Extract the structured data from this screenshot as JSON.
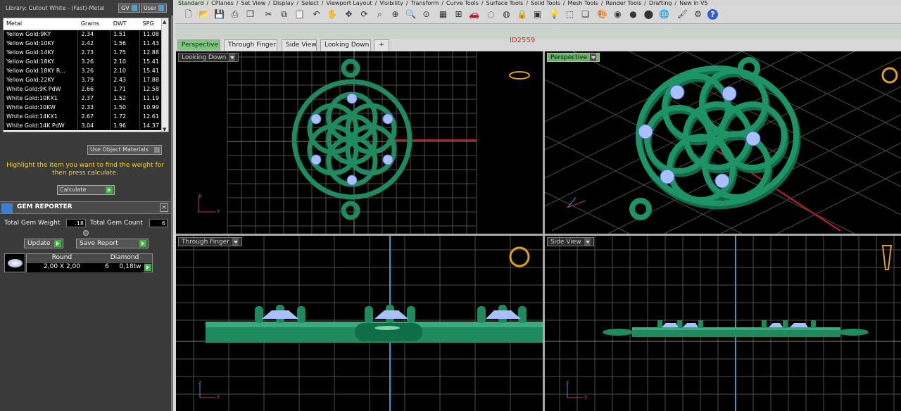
{
  "library": {
    "title": "Library: Cutout White - (Fast)-Metal",
    "btn_gv": "GV",
    "btn_user": "User"
  },
  "metal_table": {
    "headers": [
      "Metal",
      "Grams",
      "DWT",
      "SPG"
    ],
    "rows": [
      [
        "Yellow Gold:9KY",
        "2.34",
        "1.51",
        "11.08"
      ],
      [
        "Yellow Gold:10KY",
        "2.42",
        "1.56",
        "11.43"
      ],
      [
        "Yellow Gold:14KY",
        "2.73",
        "1.75",
        "12.88"
      ],
      [
        "Yellow Gold:18KY",
        "3.26",
        "2.10",
        "15.41"
      ],
      [
        "Yellow Gold:18KY R...",
        "3.26",
        "2.10",
        "15.41"
      ],
      [
        "Yellow Gold:22KY",
        "3.79",
        "2.43",
        "17.88"
      ],
      [
        "White Gold:9K PdW",
        "2.66",
        "1.71",
        "12.58"
      ],
      [
        "White Gold:10KX1",
        "2.37",
        "1.52",
        "11.19"
      ],
      [
        "White Gold:10KW",
        "2.33",
        "1.50",
        "10.99"
      ],
      [
        "White Gold:14KX1",
        "2.67",
        "1.72",
        "12.61"
      ],
      [
        "White Gold:14K PdW",
        "3.04",
        "1.96",
        "14.37"
      ]
    ]
  },
  "use_object_materials": "Use Object Materials",
  "hint": "Highlight the item you want to find the weight for then press calculate.",
  "calculate_label": "Calculate",
  "gem_reporter": {
    "title": "GEM REPORTER",
    "total_weight_label": "Total Gem Weight",
    "total_weight_value": ".18",
    "total_count_label": "Total Gem Count",
    "total_count_value": "6",
    "update_label": "Update",
    "save_label": "Save Report",
    "headers": [
      "Round",
      "Diamond"
    ],
    "row": [
      "2,00 X 2,00",
      "6",
      "0,18tw"
    ]
  },
  "menu_tabs": [
    "Standard",
    "CPlanes",
    "Set View",
    "Display",
    "Select",
    "Viewport Layout",
    "Visibility",
    "Transform",
    "Curve Tools",
    "Surface Tools",
    "Solid Tools",
    "Mesh Tools",
    "Render Tools",
    "Drafting",
    "New in V5"
  ],
  "doc_id": "ID2559",
  "view_tabs": [
    "Perspective",
    "Through Finger",
    "Side View",
    "Looking Down"
  ],
  "viewports": {
    "top_left": "Looking Down",
    "top_right": "Perspective",
    "bottom_left": "Through Finger",
    "bottom_right": "Side View"
  },
  "axes": {
    "x": "x",
    "y": "y",
    "z": "z"
  },
  "colors": {
    "metal": "#1e8a5e",
    "stone": "#a8c0ff",
    "grid": "#555555",
    "accent": "#7ec87e"
  }
}
